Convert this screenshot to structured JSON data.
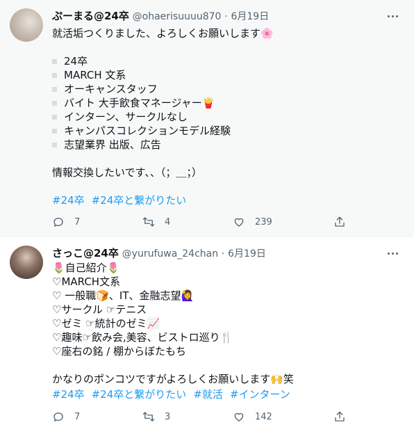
{
  "tweets": [
    {
      "name": "ぷーまる@24卒",
      "handle": "@ohaerisuuuu870",
      "sep": "·",
      "date": "6月19日",
      "intro": "就活垢つくりました、よろしくお願いします🌸",
      "bullets": [
        "24卒",
        "MARCH 文系",
        "オーキャンスタッフ",
        "バイト 大手飲食マネージャー🍟",
        "インターン、サークルなし",
        "キャンパスコレクションモデル経験",
        "志望業界  出版、広告"
      ],
      "outro": "情報交換したいです、、（；＿；）",
      "hashtags": [
        "#24卒",
        "#24卒と繋がりたい"
      ],
      "replies": "7",
      "retweets": "4",
      "likes": "239"
    },
    {
      "name": "さっこ@24卒",
      "handle": "@yurufuwa_24chan",
      "sep": "·",
      "date": "6月19日",
      "lines": [
        "🌷自己紹介🌷",
        "♡MARCH文系",
        "♡ 一般職🍞、IT、金融志望🙋‍♀️",
        "♡サークル ☞テニス",
        "♡ゼミ ☞統計のゼミ📈",
        "♡趣味☞飲み会,美容、ビストロ巡り🍴",
        "♡座右の銘 / 棚からぼたもち"
      ],
      "closing": "かなりのポンコツですがよろしくお願いします🙌笑",
      "hashtags": [
        "#24卒",
        "#24卒と繋がりたい",
        "#就活",
        "#インターン"
      ],
      "replies": "7",
      "retweets": "3",
      "likes": "142"
    }
  ],
  "icons": {
    "more": "more-horizontal-icon",
    "reply": "reply-icon",
    "retweet": "retweet-icon",
    "like": "heart-icon",
    "share": "share-icon"
  },
  "colors": {
    "link": "#1d9bf0",
    "secondary_text": "#536471",
    "highlight_bg": "#f7f9f9"
  }
}
